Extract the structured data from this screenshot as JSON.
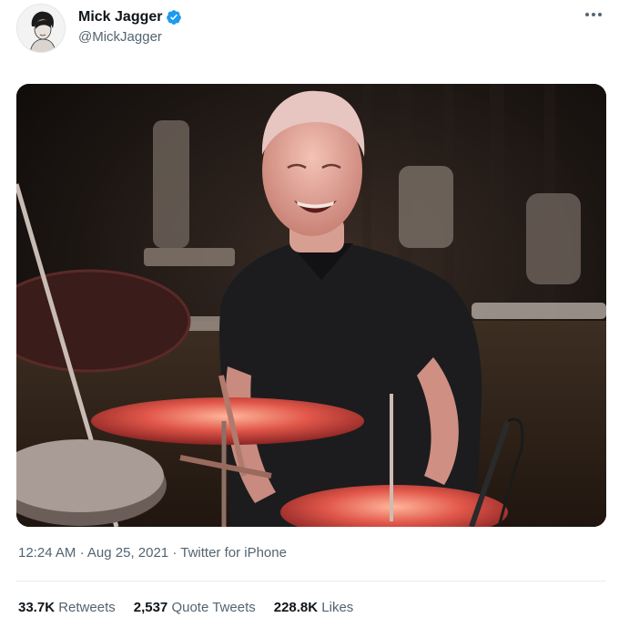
{
  "tweet": {
    "author": {
      "display_name": "Mick Jagger",
      "handle": "@MickJagger",
      "verified": true,
      "avatar_icon": "profile-photo-icon"
    },
    "more_icon": "more-dots-icon",
    "media": {
      "type": "photo"
    },
    "meta": {
      "time": "12:24 AM",
      "separator": "·",
      "date": "Aug 25, 2021",
      "separator2": "·",
      "source": "Twitter for iPhone"
    },
    "stats": {
      "retweets_count": "33.7K",
      "retweets_label": "Retweets",
      "quotes_count": "2,537",
      "quotes_label": "Quote Tweets",
      "likes_count": "228.8K",
      "likes_label": "Likes"
    }
  },
  "colors": {
    "verified_blue": "#1d9bf0",
    "secondary_text": "#536471",
    "primary_text": "#0f1419"
  }
}
